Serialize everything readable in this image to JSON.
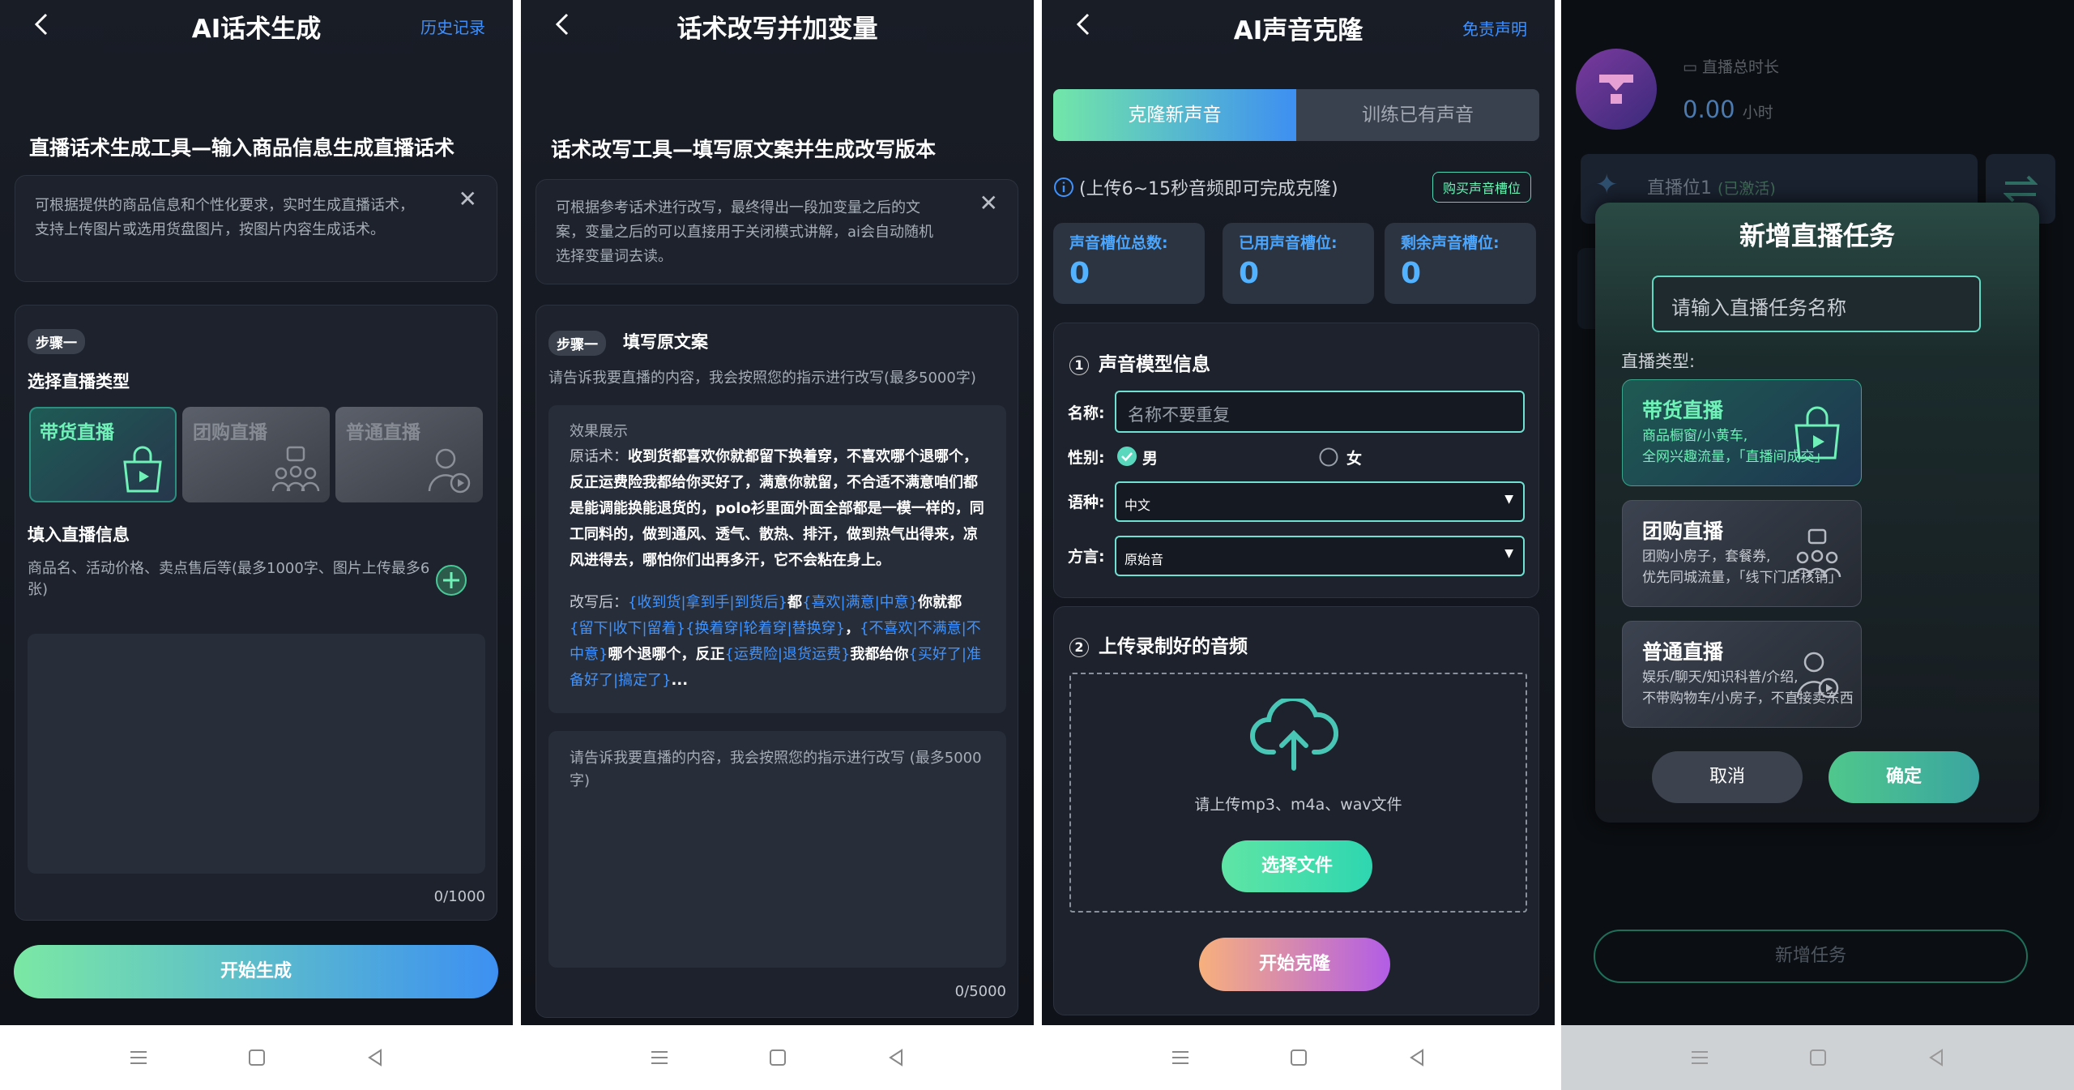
{
  "colors": {
    "accent_green": "#6ff1b8",
    "accent_blue": "#3e90ff",
    "bg": "#151920"
  },
  "p1": {
    "title": "AI话术生成",
    "history": "历史记录",
    "heading": "直播话术生成工具—输入商品信息生成直播话术",
    "desc": "可根据提供的商品信息和个性化要求，实时生成直播话术，支持上传图片或选用货盘图片，按图片内容生成话术。",
    "step": "步骤一",
    "choose_type": "选择直播类型",
    "types": [
      "带货直播",
      "团购直播",
      "普通直播"
    ],
    "fill_info": "填入直播信息",
    "fill_hint": "商品名、活动价格、卖点售后等(最多1000字、图片上传最多6张)",
    "counter": "0/1000",
    "start": "开始生成"
  },
  "p2": {
    "title": "话术改写并加变量",
    "heading": "话术改写工具—填写原文案并生成改写版本",
    "desc": "可根据参考话术进行改写，最终得出一段加变量之后的文案，变量之后的可以直接用于关闭模式讲解，ai会自动随机选择变量词去读。",
    "step": "步骤一",
    "step_title": "填写原文案",
    "hint": "请告诉我要直播的内容，我会按照您的指示进行改写(最多5000字)",
    "effect_title": "效果展示",
    "orig_label": "原话术：",
    "orig_text": "收到货都喜欢你就都留下换着穿，不喜欢哪个退哪个，反正运费险我都给你买好了，满意你就留，不合适不满意咱们都是能调能换能退货的，polo衫里面外面全部都是一模一样的，同工同料的，做到通风、透气、散热、排汗，做到热气出得来，凉风进得去，哪怕你们出再多汗，它不会粘在身上。",
    "rewrite_label": "改写后：",
    "rewrite": [
      {
        "t": "{收到货|拿到手|到货后}",
        "b": true
      },
      {
        "t": "都",
        "b": false
      },
      {
        "t": "{喜欢|满意|中意}",
        "b": true
      },
      {
        "t": "你就都",
        "b": false
      },
      {
        "t": "{留下|收下|留着}{换着穿|轮着穿|替换穿}",
        "b": true
      },
      {
        "t": "，",
        "b": false
      },
      {
        "t": "{不喜欢|不满意|不中意}",
        "b": true
      },
      {
        "t": "哪个退哪个，反正",
        "b": false
      },
      {
        "t": "{运费险|退货运费}",
        "b": true
      },
      {
        "t": "我都给你",
        "b": false
      },
      {
        "t": "{买好了|准备好了|搞定了}",
        "b": true
      },
      {
        "t": "...",
        "b": false
      }
    ],
    "input_placeholder": "请告诉我要直播的内容，我会按照您的指示进行改写 (最多5000字)",
    "counter": "0/5000"
  },
  "p3": {
    "title": "AI声音克隆",
    "disclaimer": "免责声明",
    "tabs": [
      "克隆新声音",
      "训练已有声音"
    ],
    "notice": "(上传6~15秒音频即可完成克隆)",
    "buy": "购买声音槽位",
    "stats": [
      {
        "label": "声音槽位总数:",
        "value": "0"
      },
      {
        "label": "已用声音槽位:",
        "value": "0"
      },
      {
        "label": "剩余声音槽位:",
        "value": "0"
      }
    ],
    "sec1_num": "1",
    "sec1": "声音模型信息",
    "name_label": "名称:",
    "name_placeholder": "名称不要重复",
    "gender_label": "性别:",
    "male": "男",
    "female": "女",
    "lang_label": "语种:",
    "lang_value": "中文",
    "dialect_label": "方言:",
    "dialect_value": "原始音",
    "sec2_num": "2",
    "sec2": "上传录制好的音频",
    "upload_hint": "请上传mp3、m4a、wav文件",
    "choose_file": "选择文件",
    "start": "开始克隆"
  },
  "p4": {
    "duration_label": "直播总时长",
    "duration_value": "0.00",
    "duration_unit": "小时",
    "slot_name": "直播位1",
    "slot_status": "(已激活)",
    "dialog_title": "新增直播任务",
    "name_placeholder": "请输入直播任务名称",
    "type_label": "直播类型:",
    "options": [
      {
        "title": "带货直播",
        "desc1": "商品橱窗/小黄车,",
        "desc2": "全网兴趣流量，「直播间成交」"
      },
      {
        "title": "团购直播",
        "desc1": "团购小房子，套餐券,",
        "desc2": "优先同城流量，「线下门店核销」"
      },
      {
        "title": "普通直播",
        "desc1": "娱乐/聊天/知识科普/介绍,",
        "desc2": "不带购物车/小房子，不直接卖东西"
      }
    ],
    "cancel": "取消",
    "confirm": "确定",
    "add_task": "新增任务"
  }
}
